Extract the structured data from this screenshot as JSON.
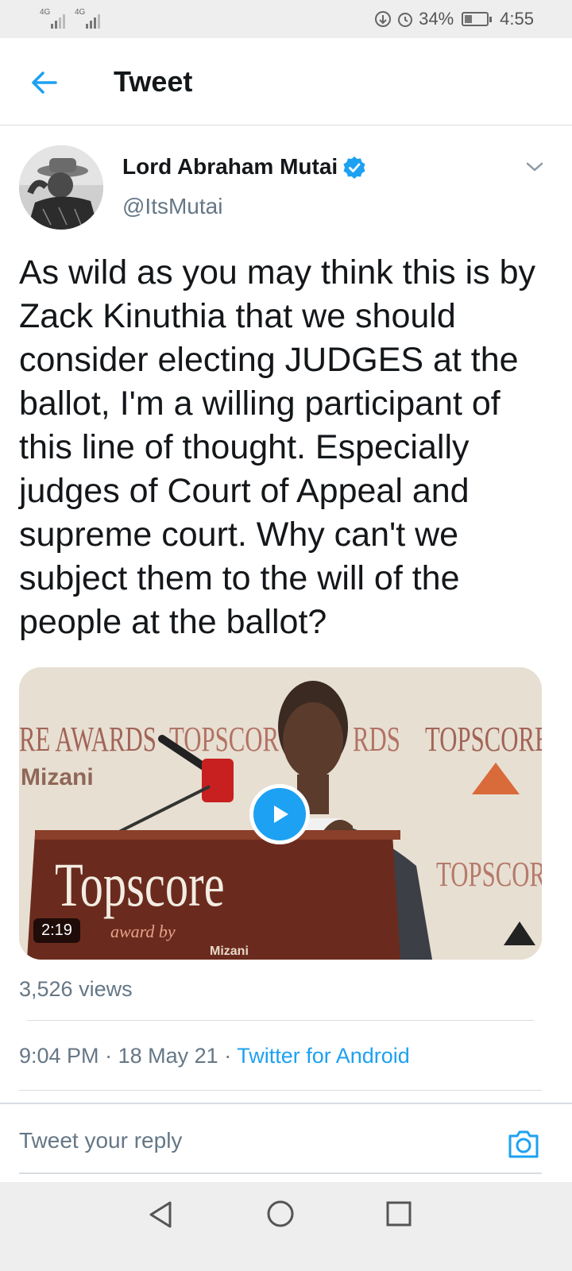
{
  "status_bar": {
    "signal1_label": "4G",
    "signal2_label": "4G",
    "battery_percent": "34%",
    "battery_level": 0.34,
    "time": "4:55",
    "icons": [
      "data-saver-icon",
      "alarm-icon",
      "battery-icon"
    ]
  },
  "header": {
    "title": "Tweet",
    "back_icon": "arrow-left-icon"
  },
  "tweet": {
    "author_name": "Lord Abraham Mutai",
    "author_handle": "@ItsMutai",
    "verified": true,
    "text": "As wild as you may think this is by Zack Kinuthia that we should consider electing JUDGES at the ballot, I'm a willing participant of this line of thought. Especially judges of Court of Appeal and supreme court. Why can't we subject them to the will of the people at the ballot?",
    "video": {
      "duration": "2:19",
      "backdrop_words": [
        "RE AWARDS",
        "TOPSCOR",
        "RDS",
        "TOPSCORE",
        "Mizani",
        "TOPSCOR",
        "Topscore",
        "award by",
        "Mizani"
      ]
    },
    "views": "3,526 views",
    "time": "9:04 PM",
    "date": "18 May 21",
    "separator": "·",
    "source": "Twitter for Android"
  },
  "reply": {
    "placeholder": "Tweet your reply"
  },
  "colors": {
    "accent": "#1da1f2",
    "secondary_text": "#657786",
    "primary_text": "#14171a",
    "divider": "#d8dde2"
  }
}
